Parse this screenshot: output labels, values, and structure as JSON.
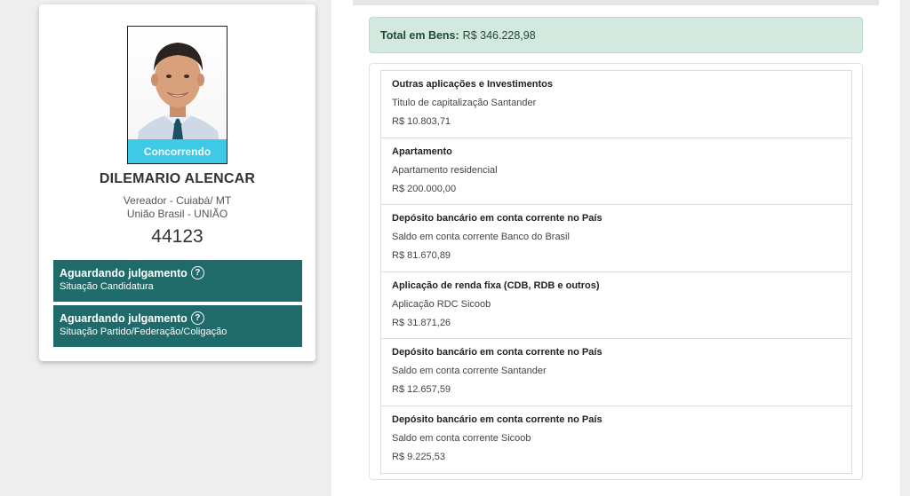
{
  "candidate": {
    "status_label": "Concorrendo",
    "name": "DILEMARIO ALENCAR",
    "role": "Vereador - Cuiabá/ MT",
    "party": "União Brasil - UNIÃO",
    "number": "44123"
  },
  "status_boxes": [
    {
      "title": "Aguardando julgamento",
      "subtitle": "Situação Candidatura"
    },
    {
      "title": "Aguardando julgamento",
      "subtitle": "Situação Partido/Federação/Coligação"
    }
  ],
  "total": {
    "label": "Total em Bens:",
    "value": "R$ 346.228,98"
  },
  "assets": [
    {
      "type": "Outras aplicações e Investimentos",
      "description": "Titulo de capitalização Santander",
      "value": "R$ 10.803,71"
    },
    {
      "type": "Apartamento",
      "description": "Apartamento residencial",
      "value": "R$ 200.000,00"
    },
    {
      "type": "Depósito bancário em conta corrente no País",
      "description": "Saldo em conta corrente Banco do Brasil",
      "value": "R$ 81.670,89"
    },
    {
      "type": "Aplicação de renda fixa (CDB, RDB e outros)",
      "description": "Aplicação RDC Sicoob",
      "value": "R$ 31.871,26"
    },
    {
      "type": "Depósito bancário em conta corrente no País",
      "description": "Saldo em conta corrente Santander",
      "value": "R$ 12.657,59"
    },
    {
      "type": "Depósito bancário em conta corrente no País",
      "description": "Saldo em conta corrente Sicoob",
      "value": "R$ 9.225,53"
    }
  ],
  "icons": {
    "help": "help-circle-icon"
  },
  "colors": {
    "status_strip": "#3ec9e6",
    "status_box": "#1f6b6a",
    "total_bg": "#d3e8de"
  }
}
